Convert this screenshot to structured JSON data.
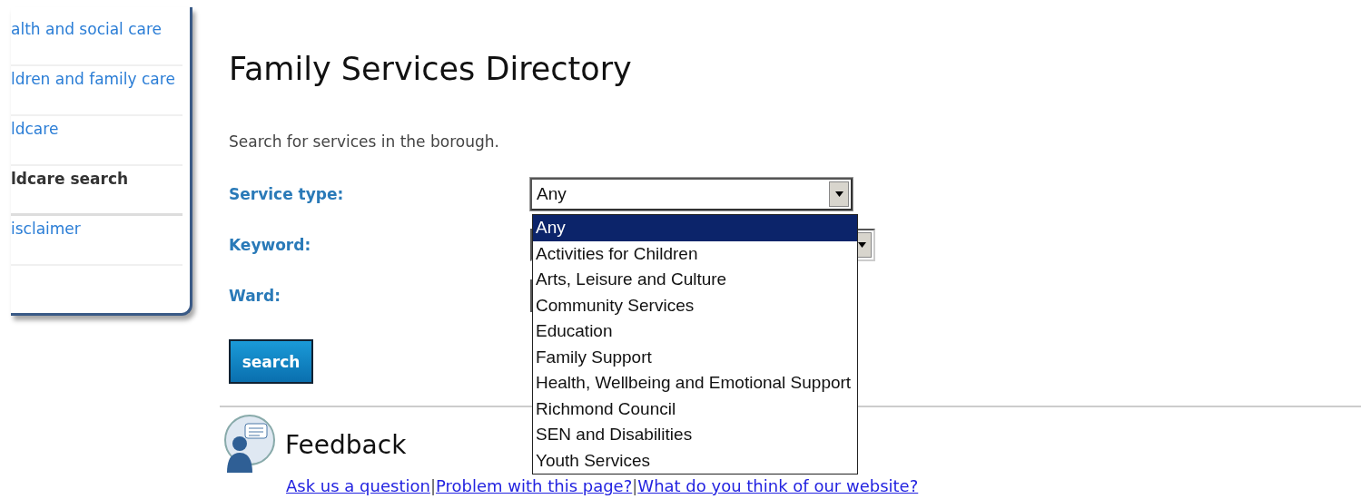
{
  "sidebar": {
    "items": [
      {
        "label": "alth and social care",
        "selected": false
      },
      {
        "label": "ldren and family care",
        "selected": false
      },
      {
        "label": "ldcare",
        "selected": false
      },
      {
        "label": "ldcare search",
        "selected": true
      },
      {
        "label": "isclaimer",
        "selected": false
      }
    ]
  },
  "page": {
    "title": "Family Services Directory",
    "intro": "Search for services in the borough."
  },
  "form": {
    "fields": [
      {
        "kind": "select",
        "label": "Service type:",
        "value": "Any",
        "expanded": true
      },
      {
        "kind": "select",
        "label": "Keyword:",
        "expanded": false
      },
      {
        "kind": "input",
        "label": "Ward:"
      }
    ],
    "options": [
      {
        "label": "Any",
        "selected": true
      },
      {
        "label": "Activities for Children",
        "selected": false
      },
      {
        "label": "Arts, Leisure and Culture",
        "selected": false
      },
      {
        "label": "Community Services",
        "selected": false
      },
      {
        "label": "Education",
        "selected": false
      },
      {
        "label": "Family Support",
        "selected": false
      },
      {
        "label": "Health, Wellbeing and Emotional Support",
        "selected": false
      },
      {
        "label": "Richmond Council",
        "selected": false
      },
      {
        "label": "SEN and Disabilities",
        "selected": false
      },
      {
        "label": "Youth Services",
        "selected": false
      }
    ],
    "submit": "search"
  },
  "feedback": {
    "title": "Feedback",
    "links": [
      "Ask us a question",
      "Problem with this page?",
      "What do you think of our website?"
    ],
    "separator": "|"
  }
}
